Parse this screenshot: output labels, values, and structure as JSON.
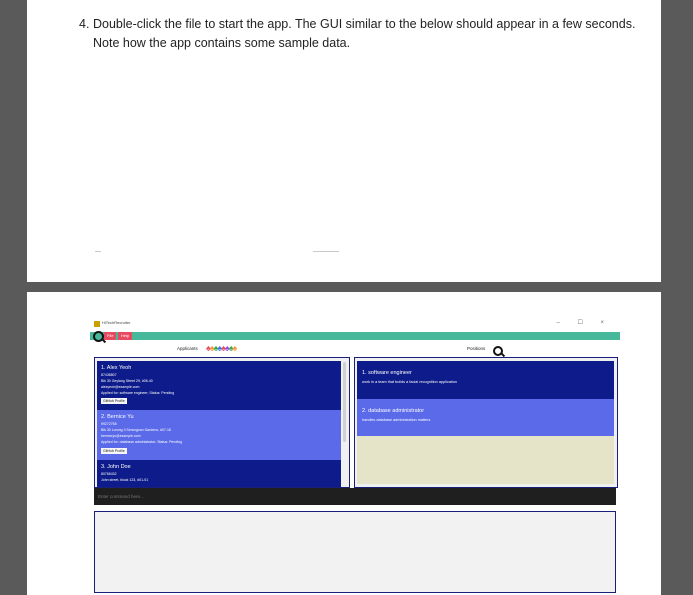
{
  "document": {
    "step_number": "4.",
    "step_text": "Double-click the file to start the app. The GUI similar to the below should appear in a few seconds. Note how the app contains some sample data."
  },
  "app": {
    "title": "HiTechRecruiter",
    "window_controls": "– ☐ ×",
    "menu": [
      "File",
      "Help"
    ],
    "applicants_title": "Applicants",
    "positions_title": "Positions",
    "people_icons": "👫👥👫👥",
    "applicants": [
      {
        "name": "1.  Alex Yeoh",
        "phone": "87438807",
        "address": "Blk 30 Geylang Street 29, #06-40",
        "email": "alexyeoh@example.com",
        "applied": "Applied for: software engineer; Status: Pending",
        "github": "GitHub Profile"
      },
      {
        "name": "2.  Bernice Yu",
        "phone": "99272758",
        "address": "Blk 30 Lorong 3 Serangoon Gardens, #07-18",
        "email": "berniceyu@example.com",
        "applied": "Applied for: database administrator; Status: Pending",
        "github": "GitHub Profile"
      },
      {
        "name": "3.  John Doe",
        "phone": "80765432",
        "address": "John street, block 123, #01-01"
      }
    ],
    "positions": [
      {
        "name": "1.  software engineer",
        "description": "work in a team that builds a facial recognition application"
      },
      {
        "name": "2.  database administrator",
        "description": "handles database administration matters"
      }
    ],
    "command_placeholder": "Enter command here...",
    "colors": {
      "menubar": "#47b89a",
      "menu_button": "#e84a5f",
      "card_dark": "#0d1c8a",
      "card_light": "#5a6ae8",
      "positions_empty": "#e6e4c8",
      "command_bg": "#1f1f1f"
    }
  }
}
